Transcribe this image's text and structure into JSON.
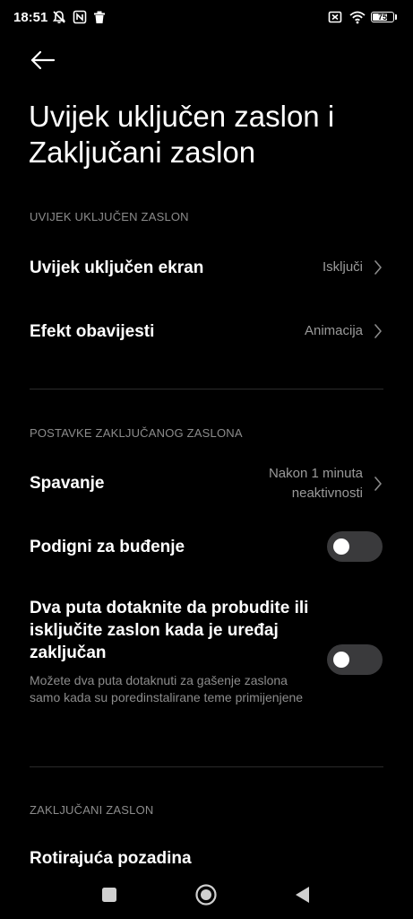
{
  "status_bar": {
    "time": "18:51",
    "battery_level": "75",
    "battery_fraction": 0.75,
    "icons": [
      "mute-icon",
      "nfc-icon",
      "trash-icon",
      "no-sim-icon",
      "wifi-icon",
      "battery-icon"
    ]
  },
  "header": {
    "back_icon": "arrow-left-icon",
    "title": "Uvijek uključen zaslon i Zaključani zaslon"
  },
  "sections": {
    "always_on": {
      "header": "UVIJEK UKLJUČEN ZASLON",
      "items": [
        {
          "label": "Uvijek uključen ekran",
          "value": "Isključi"
        },
        {
          "label": "Efekt obavijesti",
          "value": "Animacija"
        }
      ]
    },
    "lock_settings": {
      "header": "POSTAVKE ZAKLJUČANOG ZASLONA",
      "sleep": {
        "label": "Spavanje",
        "value_line1": "Nakon 1 minuta",
        "value_line2": "neaktivnosti"
      },
      "raise_to_wake": {
        "label": "Podigni za buđenje",
        "enabled": false
      },
      "double_tap": {
        "label": "Dva puta dotaknite da probudite ili isključite zaslon kada je uređaj zaključan",
        "description": "Možete dva puta dotaknuti za gašenje zaslona samo kada su poredinstalirane teme primijenjene",
        "enabled": false
      }
    },
    "lock_screen": {
      "header": "ZAKLJUČANI ZASLON",
      "items": [
        {
          "label": "Rotirajuća pozadina"
        }
      ]
    }
  },
  "nav_bar": {
    "icons": [
      "recents-square-icon",
      "home-circle-icon",
      "back-triangle-icon"
    ]
  }
}
